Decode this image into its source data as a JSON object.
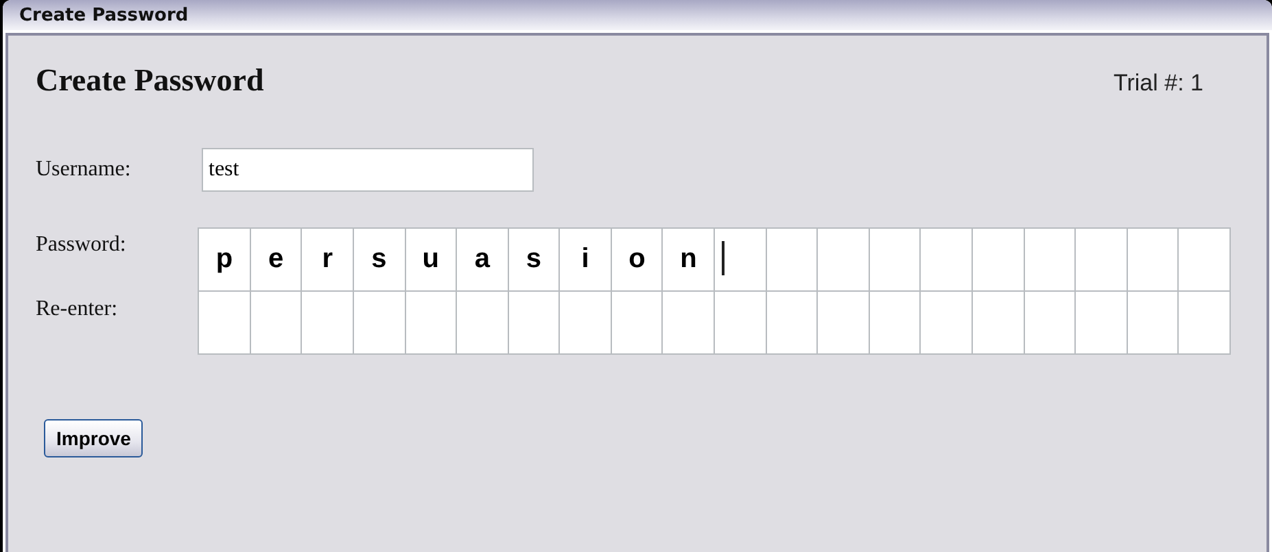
{
  "window": {
    "title": "Create Password"
  },
  "heading": "Create Password",
  "trial": "Trial #: 1",
  "username": {
    "label": "Username:",
    "value": "test"
  },
  "password": {
    "label": "Password:",
    "cells": [
      {
        "char": "p",
        "cursor": false
      },
      {
        "char": "e",
        "cursor": false
      },
      {
        "char": "r",
        "cursor": false
      },
      {
        "char": "s",
        "cursor": false
      },
      {
        "char": "u",
        "cursor": false
      },
      {
        "char": "a",
        "cursor": false
      },
      {
        "char": "s",
        "cursor": false
      },
      {
        "char": "i",
        "cursor": false
      },
      {
        "char": "o",
        "cursor": false
      },
      {
        "char": "n",
        "cursor": false
      },
      {
        "cursor": true
      },
      {
        "cursor": false
      },
      {
        "cursor": false
      },
      {
        "cursor": false
      },
      {
        "cursor": false
      },
      {
        "cursor": false
      },
      {
        "cursor": false
      },
      {
        "cursor": false
      },
      {
        "cursor": false
      },
      {
        "cursor": false
      }
    ]
  },
  "reenter": {
    "label": "Re-enter:",
    "cells": [
      {
        "cursor": false
      },
      {
        "cursor": false
      },
      {
        "cursor": false
      },
      {
        "cursor": false
      },
      {
        "cursor": false
      },
      {
        "cursor": false
      },
      {
        "cursor": false
      },
      {
        "cursor": false
      },
      {
        "cursor": false
      },
      {
        "cursor": false
      },
      {
        "cursor": false
      },
      {
        "cursor": false
      },
      {
        "cursor": false
      },
      {
        "cursor": false
      },
      {
        "cursor": false
      },
      {
        "cursor": false
      },
      {
        "cursor": false
      },
      {
        "cursor": false
      },
      {
        "cursor": false
      },
      {
        "cursor": false
      }
    ]
  },
  "buttons": [
    "Improve"
  ]
}
